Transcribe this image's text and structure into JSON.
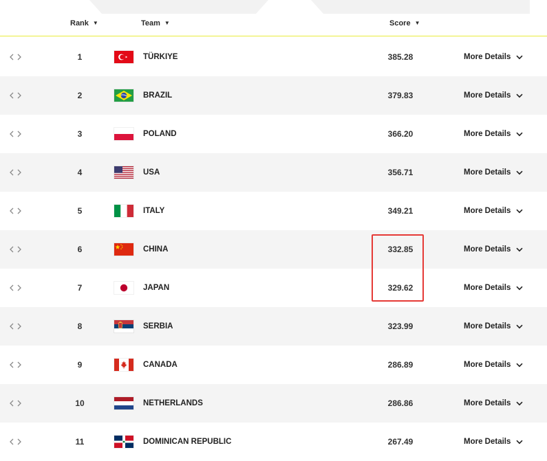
{
  "header": {
    "rank_label": "Rank",
    "team_label": "Team",
    "score_label": "Score",
    "sort_icon": "caret-down-icon"
  },
  "row_action_label": "More Details",
  "colors": {
    "accent_line": "#e9ec3a",
    "highlight": "#e53935",
    "row_alt": "#f4f4f4"
  },
  "rows": [
    {
      "rank": "1",
      "team": "TÜRKIYE",
      "score": "385.28",
      "flag": "turkey-flag-icon"
    },
    {
      "rank": "2",
      "team": "BRAZIL",
      "score": "379.83",
      "flag": "brazil-flag-icon"
    },
    {
      "rank": "3",
      "team": "POLAND",
      "score": "366.20",
      "flag": "poland-flag-icon"
    },
    {
      "rank": "4",
      "team": "USA",
      "score": "356.71",
      "flag": "usa-flag-icon"
    },
    {
      "rank": "5",
      "team": "ITALY",
      "score": "349.21",
      "flag": "italy-flag-icon"
    },
    {
      "rank": "6",
      "team": "CHINA",
      "score": "332.85",
      "flag": "china-flag-icon"
    },
    {
      "rank": "7",
      "team": "JAPAN",
      "score": "329.62",
      "flag": "japan-flag-icon"
    },
    {
      "rank": "8",
      "team": "SERBIA",
      "score": "323.99",
      "flag": "serbia-flag-icon"
    },
    {
      "rank": "9",
      "team": "CANADA",
      "score": "286.89",
      "flag": "canada-flag-icon"
    },
    {
      "rank": "10",
      "team": "NETHERLANDS",
      "score": "286.86",
      "flag": "netherlands-flag-icon"
    },
    {
      "rank": "11",
      "team": "DOMINICAN REPUBLIC",
      "score": "267.49",
      "flag": "dominican-republic-flag-icon"
    }
  ]
}
